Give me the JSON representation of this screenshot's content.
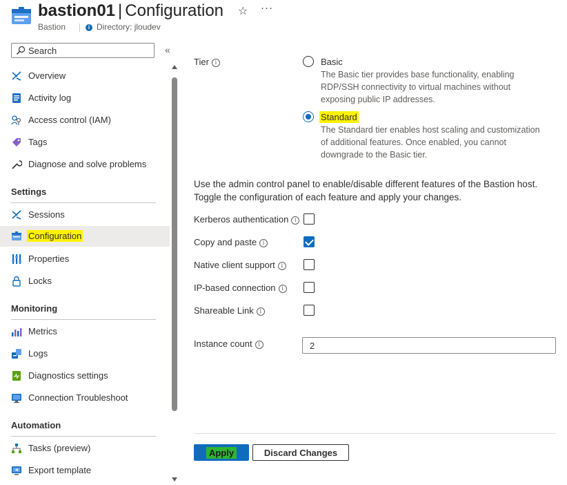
{
  "header": {
    "resource_name": "bastion01",
    "page_name": "Configuration",
    "separator": "|",
    "resource_type": "Bastion",
    "directory": "Directory: jloudev"
  },
  "sidebar": {
    "search_placeholder": "Search",
    "top_items": [
      {
        "label": "Overview",
        "icon": "overview-icon"
      },
      {
        "label": "Activity log",
        "icon": "activity-log-icon"
      },
      {
        "label": "Access control (IAM)",
        "icon": "iam-icon"
      },
      {
        "label": "Tags",
        "icon": "tag-icon"
      },
      {
        "label": "Diagnose and solve problems",
        "icon": "wrench-icon"
      }
    ],
    "sections": [
      {
        "title": "Settings",
        "items": [
          {
            "label": "Sessions",
            "icon": "sessions-icon"
          },
          {
            "label": "Configuration",
            "icon": "configuration-icon",
            "selected": true
          },
          {
            "label": "Properties",
            "icon": "properties-icon"
          },
          {
            "label": "Locks",
            "icon": "lock-icon"
          }
        ]
      },
      {
        "title": "Monitoring",
        "items": [
          {
            "label": "Metrics",
            "icon": "metrics-icon"
          },
          {
            "label": "Logs",
            "icon": "logs-icon"
          },
          {
            "label": "Diagnostics settings",
            "icon": "diagnostics-icon"
          },
          {
            "label": "Connection Troubleshoot",
            "icon": "monitor-icon"
          }
        ]
      },
      {
        "title": "Automation",
        "items": [
          {
            "label": "Tasks (preview)",
            "icon": "tasks-icon"
          },
          {
            "label": "Export template",
            "icon": "export-icon"
          }
        ]
      }
    ]
  },
  "main": {
    "tier_label": "Tier",
    "tiers": [
      {
        "name": "Basic",
        "selected": false,
        "description": "The Basic tier provides base functionality, enabling RDP/SSH connectivity to virtual machines without exposing public IP addresses."
      },
      {
        "name": "Standard",
        "selected": true,
        "description": "The Standard tier enables host scaling and customization of additional features. Once enabled, you cannot downgrade to the Basic tier."
      }
    ],
    "intro": "Use the admin control panel to enable/disable different features of the Bastion host. Toggle the configuration of each feature and apply your changes.",
    "features": [
      {
        "label": "Kerberos authentication",
        "checked": false
      },
      {
        "label": "Copy and paste",
        "checked": true
      },
      {
        "label": "Native client support",
        "checked": false
      },
      {
        "label": "IP-based connection",
        "checked": false
      },
      {
        "label": "Shareable Link",
        "checked": false
      }
    ],
    "instance_count_label": "Instance count",
    "instance_count_value": "2",
    "apply_label": "Apply",
    "discard_label": "Discard Changes"
  },
  "colors": {
    "accent": "#0f6cbd",
    "highlight_yellow": "#fff200",
    "highlight_green": "#2db531",
    "selected_nav_bg": "#edebe9"
  }
}
